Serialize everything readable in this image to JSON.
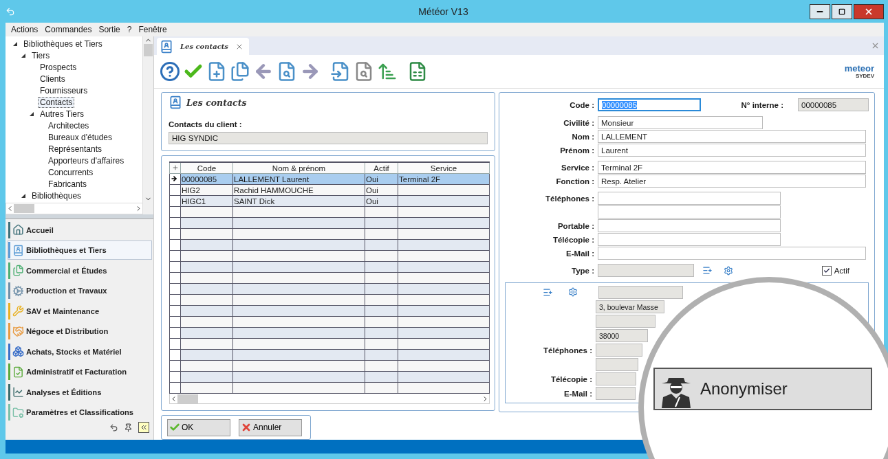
{
  "window": {
    "title": "Météor V13"
  },
  "menu": [
    "Actions",
    "Commandes",
    "Sortie",
    "?",
    "Fenêtre"
  ],
  "tree": [
    {
      "label": "Bibliothèques et Tiers",
      "expanded": true,
      "selected": false,
      "children": [
        {
          "label": "Tiers",
          "expanded": true,
          "selected": false,
          "children": [
            {
              "label": "Prospects",
              "selected": false
            },
            {
              "label": "Clients",
              "selected": false
            },
            {
              "label": "Fournisseurs",
              "selected": false
            },
            {
              "label": "Contacts",
              "selected": true
            },
            {
              "label": "Autres Tiers",
              "expanded": true,
              "selected": false,
              "children": [
                {
                  "label": "Architectes",
                  "selected": false
                },
                {
                  "label": "Bureaux d'études",
                  "selected": false
                },
                {
                  "label": "Représentants",
                  "selected": false
                },
                {
                  "label": "Apporteurs d'affaires",
                  "selected": false
                },
                {
                  "label": "Concurrents",
                  "selected": false
                },
                {
                  "label": "Fabricants",
                  "selected": false
                }
              ]
            }
          ]
        },
        {
          "label": "Bibliothèques",
          "expanded": true,
          "selected": false
        }
      ]
    }
  ],
  "nav": [
    {
      "kind": "home",
      "label": "Accueil",
      "color": "#3e6f78",
      "selected": false
    },
    {
      "kind": "library",
      "label": "Bibliothèques et Tiers",
      "color": "#5b9bd5",
      "selected": true
    },
    {
      "kind": "commercial",
      "label": "Commercial et Études",
      "color": "#4caf72",
      "selected": false
    },
    {
      "kind": "production",
      "label": "Production et Travaux",
      "color": "#6f8fa8",
      "selected": false
    },
    {
      "kind": "service",
      "label": "SAV et Maintenance",
      "color": "#e8b020",
      "selected": false
    },
    {
      "kind": "trade",
      "label": "Négoce et Distribution",
      "color": "#e89a40",
      "selected": false
    },
    {
      "kind": "purchase",
      "label": "Achats, Stocks et Matériel",
      "color": "#3a6fc8",
      "selected": false
    },
    {
      "kind": "admin",
      "label": "Administratif et Facturation",
      "color": "#5aaa3a",
      "selected": false
    },
    {
      "kind": "analysis",
      "label": "Analyses et Éditions",
      "color": "#3a6a6a",
      "selected": false
    },
    {
      "kind": "settings",
      "label": "Paramètres et Classifications",
      "color": "#7ac0a8",
      "selected": false
    }
  ],
  "tabs": [
    {
      "label": "Les contacts",
      "selected": true
    }
  ],
  "logo": {
    "name": "meteor",
    "sub": "SYDEV"
  },
  "header_panel": {
    "title": "Les contacts",
    "client_label": "Contacts du client :",
    "client_value": "HIG SYNDIC"
  },
  "table": {
    "columns": [
      "Code",
      "Nom & prénom",
      "Actif",
      "Service"
    ],
    "rows": [
      {
        "cells": [
          "00000085",
          "LALLEMENT Laurent",
          "Oui",
          "Terminal 2F"
        ],
        "selected": true
      },
      {
        "cells": [
          "HIG2",
          "Rachid HAMMOUCHE",
          "Oui",
          ""
        ],
        "selected": false
      },
      {
        "cells": [
          "HIGC1",
          "SAINT Dick",
          "Oui",
          ""
        ],
        "selected": false
      }
    ]
  },
  "buttons": [
    {
      "kind": "ok",
      "label": "OK"
    },
    {
      "kind": "cancel",
      "label": "Annuler"
    }
  ],
  "form": {
    "code": {
      "label": "Code :",
      "value": "00000085",
      "focused": true
    },
    "internal": {
      "label": "N° interne :",
      "value": "00000085"
    },
    "groups": [
      [
        {
          "kind": "medium",
          "label": "Civilité :",
          "value": "Monsieur"
        },
        {
          "kind": "full",
          "label": "Nom :",
          "value": "LALLEMENT"
        },
        {
          "kind": "full",
          "label": "Prénom :",
          "value": "Laurent"
        }
      ],
      [
        {
          "kind": "full",
          "label": "Service :",
          "value": "Terminal 2F"
        },
        {
          "kind": "full",
          "label": "Fonction :",
          "value": "Resp. Atelier"
        }
      ],
      [
        {
          "kind": "phone",
          "label": "Téléphones :"
        },
        {
          "kind": "phone"
        },
        {
          "kind": "phone",
          "label": "Portable :"
        },
        {
          "kind": "phone",
          "label": "Télécopie :"
        },
        {
          "kind": "full",
          "label": "E-Mail :"
        }
      ]
    ],
    "type": {
      "label": "Type :"
    },
    "active": {
      "label": "Actif",
      "checked": true
    }
  },
  "address": [
    {
      "kind": "icons"
    },
    {
      "kind": "plain",
      "value": "3, boulevar Masse"
    },
    {
      "kind": "plain"
    },
    {
      "kind": "plain",
      "value": "38000"
    },
    {
      "kind": "plain",
      "label": "Téléphones :"
    },
    {
      "kind": "plain"
    },
    {
      "kind": "plain",
      "label": "Télécopie :"
    },
    {
      "kind": "plain",
      "label": "E-Mail :"
    }
  ],
  "magnifier": {
    "button": "Anonymiser"
  }
}
